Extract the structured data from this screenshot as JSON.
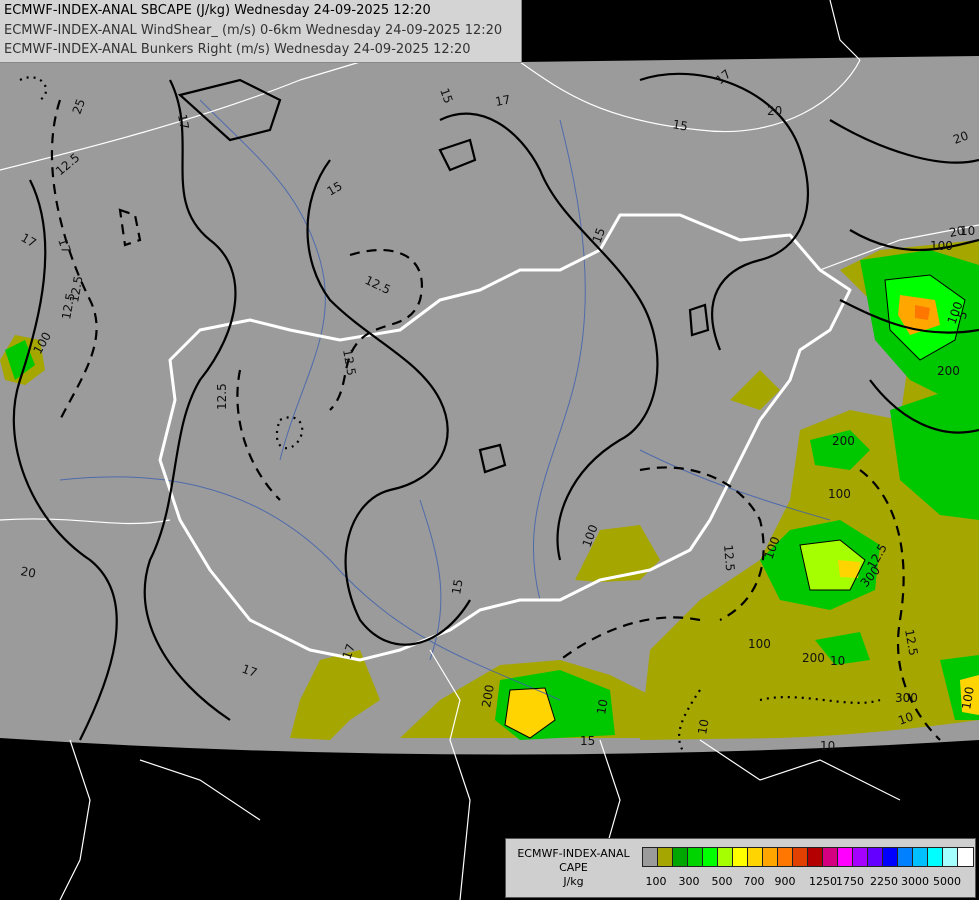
{
  "header": {
    "line1": "ECMWF-INDEX-ANAL SBCAPE (J/kg) Wednesday 24-09-2025 12:20",
    "line2": "ECMWF-INDEX-ANAL WindShear_ (m/s) 0-6km Wednesday 24-09-2025 12:20",
    "line3": "ECMWF-INDEX-ANAL Bunkers Right (m/s) Wednesday 24-09-2025 12:20"
  },
  "legend": {
    "title_line1": "ECMWF-INDEX-ANAL",
    "title_line2": "CAPE",
    "title_line3": "J/kg",
    "colors": [
      "#9b9b9b",
      "#a6a600",
      "#00a600",
      "#00d400",
      "#00ff00",
      "#a6ff00",
      "#ffff00",
      "#ffd400",
      "#ffa600",
      "#ff7700",
      "#e24000",
      "#b40000",
      "#d4007f",
      "#ff00ff",
      "#a600ff",
      "#6400ff",
      "#0000ff",
      "#0080ff",
      "#00c0ff",
      "#00ffff",
      "#a6ffff",
      "#ffffff"
    ],
    "tick_labels": [
      "100",
      "300",
      "500",
      "700",
      "900",
      "1250",
      "1750",
      "2250",
      "3000",
      "5000"
    ]
  },
  "contour_labels": {
    "shear": [
      "12.5",
      "12.5",
      "12.5",
      "12.5",
      "12.5",
      "12.5",
      "12.5",
      "12.5",
      "12.5",
      "15",
      "15",
      "15",
      "15",
      "15",
      "15",
      "17",
      "17",
      "17",
      "17",
      "17",
      "17",
      "20",
      "20",
      "20",
      "20",
      "25",
      "10",
      "10",
      "10",
      "10",
      "10",
      "17",
      "5",
      "10",
      "25"
    ],
    "cape": [
      "100",
      "100",
      "100",
      "100",
      "100",
      "200",
      "200",
      "300",
      "200",
      "100",
      "100",
      "100",
      "200",
      "300"
    ]
  }
}
